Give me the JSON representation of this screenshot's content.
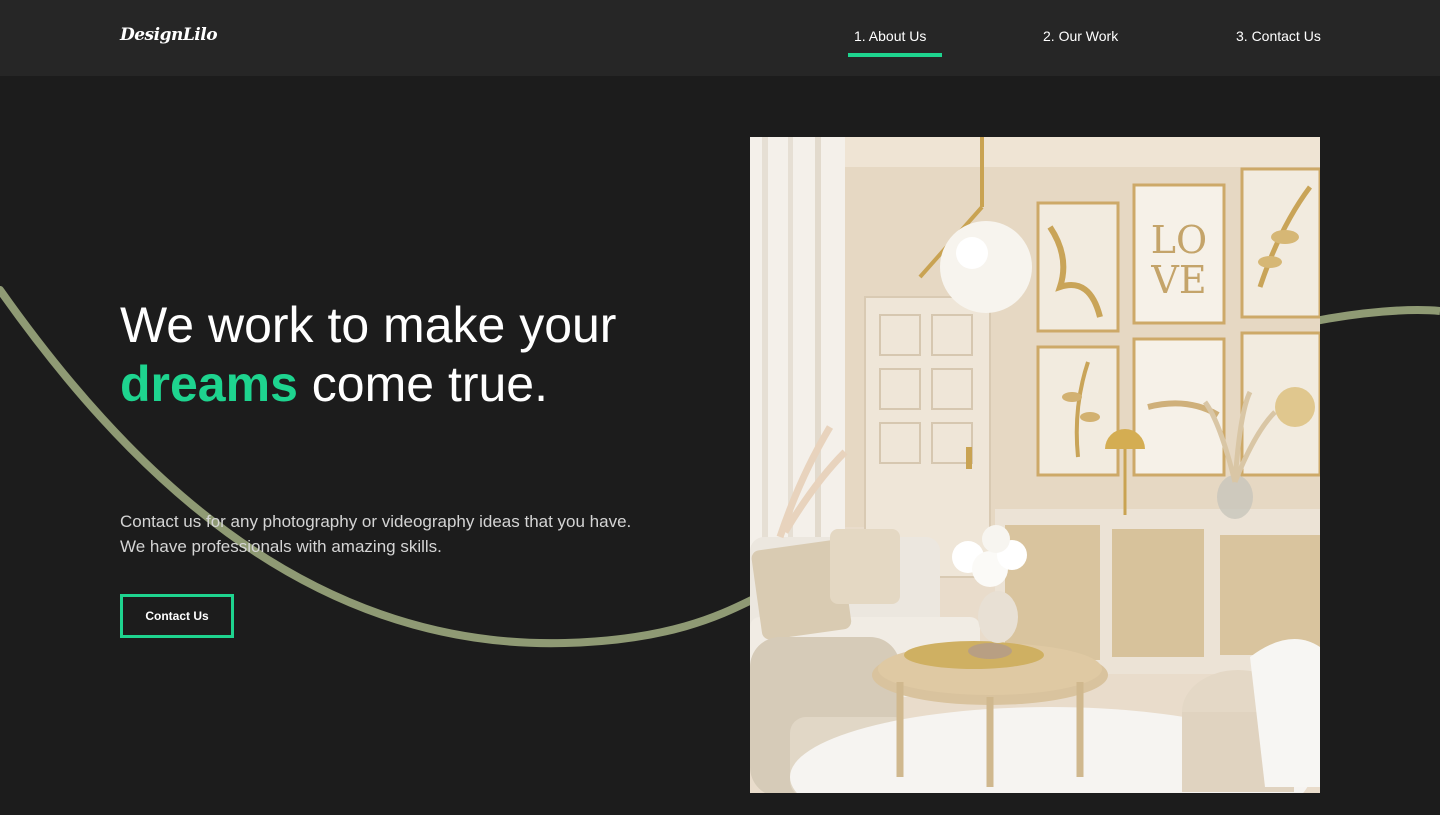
{
  "brand": {
    "logo_text": "DesignLilo"
  },
  "nav": {
    "items": [
      {
        "label": "1. About Us",
        "active": true
      },
      {
        "label": "2. Our Work",
        "active": false
      },
      {
        "label": "3. Contact Us",
        "active": false
      }
    ]
  },
  "hero": {
    "title_part1": "We work to make your ",
    "title_accent": "dreams",
    "title_part2": " come true.",
    "subtitle_line1": "Contact us for any photography or videography ideas that you have.",
    "subtitle_line2": "We have professionals with amazing skills.",
    "cta_label": "Contact Us"
  },
  "photo": {
    "subject": "interior-living-room-image",
    "poster_text_1": "LO",
    "poster_text_2": "VE"
  },
  "colors": {
    "background": "#1c1c1c",
    "nav_background": "#262626",
    "accent": "#1ed48f",
    "curve": "#8f9a74"
  }
}
